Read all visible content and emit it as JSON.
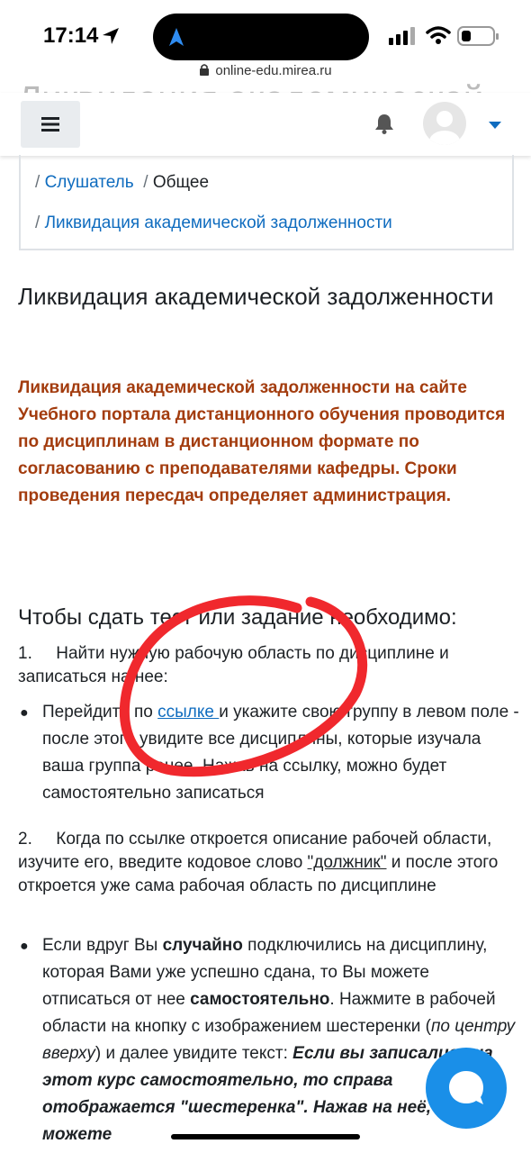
{
  "status": {
    "time": "17:14"
  },
  "browser": {
    "url": "online-edu.mirea.ru"
  },
  "header": {
    "ghost_title": "Ликвидация академической задолж"
  },
  "breadcrumb": {
    "items": [
      {
        "label": "Слушатель",
        "link": true
      },
      {
        "label": "Общее",
        "link": false
      },
      {
        "label": "Ликвидация академической задолженности",
        "link": true
      }
    ]
  },
  "page": {
    "title": "Ликвидация академической задолженности",
    "notice": "Ликвидация академической задолженности на сайте Учебного портала дистанционного обучения проводится по дисциплинам в дистанционном формате по согласованию с преподавателями кафедры. Сроки проведения пересдач определяет администрация.",
    "steps_heading": "Чтобы сдать тест или задание необходимо:",
    "step1": {
      "num": "1.",
      "text": "Найти нужную рабочую область по дисциплине и записаться на нее:",
      "bullet_pre": "Перейдите по ",
      "bullet_link": "ссылке ",
      "bullet_post": "и укажите свою группу в левом поле - после этого увидите все дисциплины, которые изучала ваша группа ранее. Нажав на ссылку, можно будет самостоятельно записаться"
    },
    "step2": {
      "num": "2.",
      "text_pre": "Когда по ссылке откроется описание рабочей области, изучите его, введите кодовое слово ",
      "keyword": "\"должник\"",
      "text_post": " и после этого откроется уже сама рабочая область по дисциплине",
      "b_1": "Если вдруг Вы ",
      "b_2": "случайно",
      "b_3": " подключились на дисциплину, которая Вами уже успешно сдана, то Вы можете отписаться от нее ",
      "b_4": "самостоятельно",
      "b_5": ". Нажмите в рабочей области на кнопку с изображением шестеренки (",
      "b_6": "по центру вверху",
      "b_7": ") и далее увидите текст: ",
      "b_8": "Если вы записались на этот курс самостоятельно, то справа отображается \"шестеренка\". Нажав на неё, вы можете"
    }
  },
  "colors": {
    "link": "#0f6cbf",
    "notice": "#a33c0e",
    "annotation": "#f0282d",
    "chat": "#1a8fe8"
  }
}
